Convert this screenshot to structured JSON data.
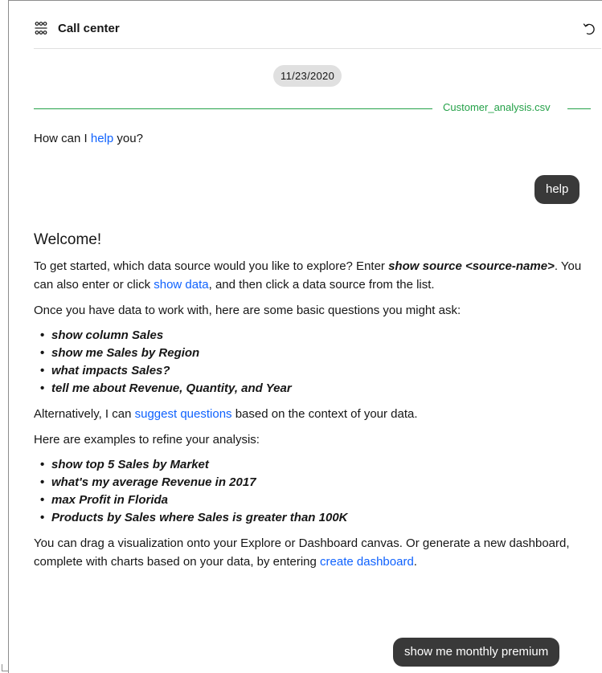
{
  "header": {
    "title": "Call center",
    "icon": "data-grid-icon",
    "reset_icon": "reset-icon"
  },
  "date": "11/23/2020",
  "source": "Customer_analysis.csv",
  "colors": {
    "link": "#0f62fe",
    "source_green": "#24a148",
    "bubble": "#393939"
  },
  "prompt": {
    "before": "How can I ",
    "link": "help",
    "after": " you?"
  },
  "user_messages": {
    "help": "help",
    "premium": "show me monthly premium"
  },
  "welcome": {
    "title": "Welcome!",
    "p1_a": "To get started, which data source would you like to explore? Enter ",
    "p1_cmd": "show source <source-name>",
    "p1_b": ". You can also enter or click ",
    "p1_link": "show data",
    "p1_c": ", and then click a data source from the list.",
    "p2": "Once you have data to work with, here are some basic questions you might ask:",
    "basic": [
      "show column Sales",
      "show me Sales by Region",
      "what impacts Sales?",
      "tell me about Revenue, Quantity, and Year"
    ],
    "p3_a": "Alternatively, I can ",
    "p3_link": "suggest questions",
    "p3_b": " based on the context of your data.",
    "p4": "Here are examples to refine your analysis:",
    "refine": [
      "show top 5 Sales by Market",
      "what's my average Revenue in 2017",
      "max Profit in Florida",
      "Products by Sales where Sales is greater than 100K"
    ],
    "p5_a": "You can drag a visualization onto your Explore or Dashboard canvas. Or generate a new dashboard, complete with charts based on your data, by entering ",
    "p5_link": "create dashboard",
    "p5_b": "."
  }
}
